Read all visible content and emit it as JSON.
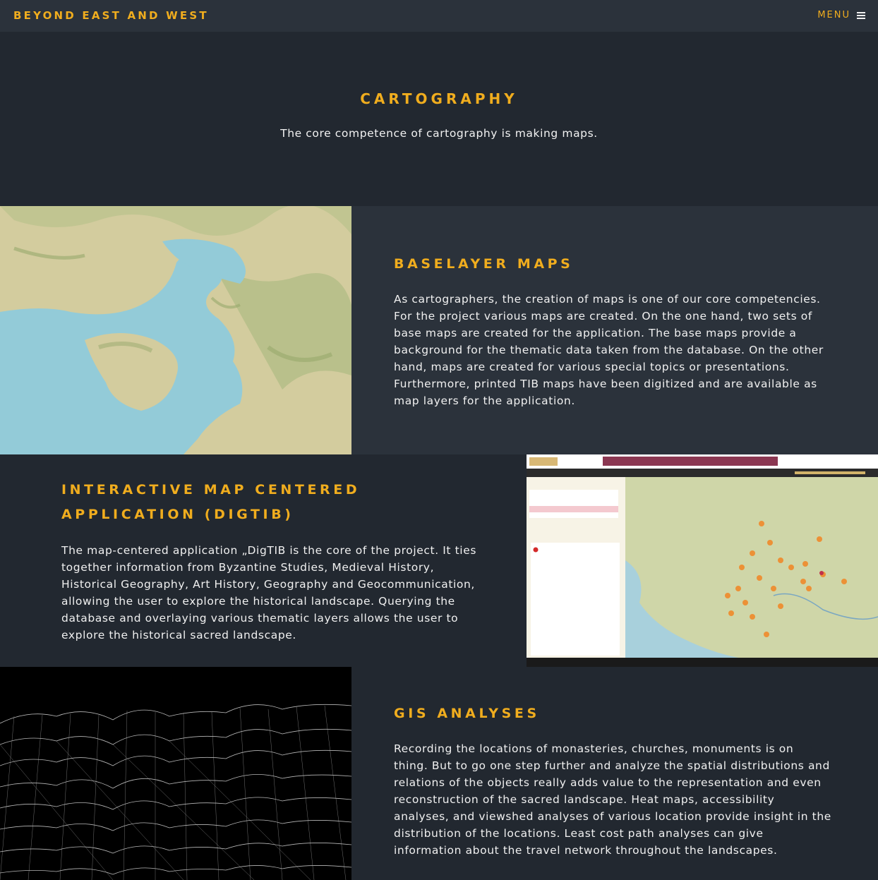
{
  "header": {
    "brand": "BEYOND EAST AND WEST",
    "menu_label": "MENU"
  },
  "intro": {
    "title": "CARTOGRAPHY",
    "text": "The core competence of cartography is making maps."
  },
  "sections": [
    {
      "title": "BASELAYER MAPS",
      "text": "As cartographers, the creation of maps is one of our core competencies. For the project various maps are created. On the one hand, two sets of base maps are created for the application. The base maps provide a background for the thematic data taken from the database. On the other hand, maps are created for various special topics or presentations. Furthermore, printed TIB maps have been digitized and are available as map layers for the application."
    },
    {
      "title": "INTERACTIVE MAP CENTERED APPLICATION (DIGTIB)",
      "text": "The map-centered application „DigTIB is the core of the project. It ties together information from Byzantine Studies, Medieval History, Historical Geography, Art History, Geography and Geocommunication, allowing the user to explore the historical landscape. Querying the database and overlaying various thematic layers allows the user to explore the historical sacred landscape."
    },
    {
      "title": "GIS ANALYSES",
      "text": "Recording the locations of monasteries, churches, monuments is on thing. But to go one step further and analyze the spatial distributions and relations of the objects really adds value to the representation and even reconstruction of the sacred landscape. Heat maps, accessibility analyses, and viewshed analyses of various location provide insight in the distribution of the locations. Least cost path analyses can give information about the travel network throughout the landscapes."
    }
  ],
  "colors": {
    "accent": "#f0ad1e",
    "header_bg": "#2b323b",
    "page_bg": "#222830"
  }
}
